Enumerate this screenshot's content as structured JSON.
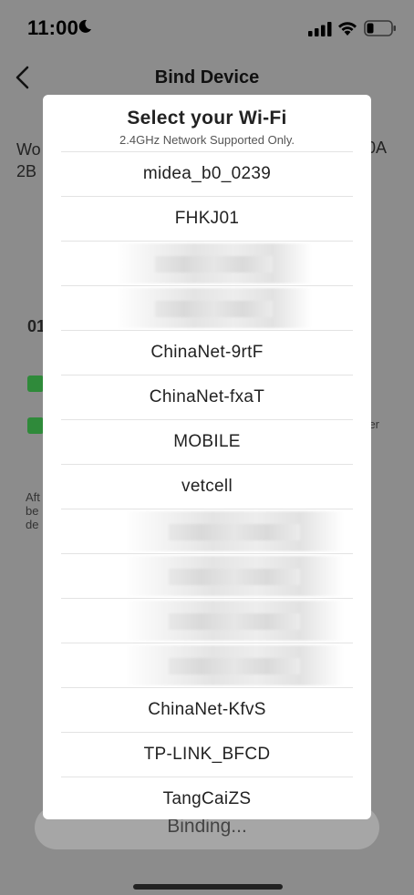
{
  "status_bar": {
    "time": "11:00",
    "icons": [
      "moon-icon",
      "signal-icon",
      "wifi-icon",
      "battery-icon"
    ]
  },
  "nav": {
    "title": "Bind Device",
    "back_icon": "chevron-left-icon"
  },
  "background": {
    "line1": "Wo",
    "line2": "2B",
    "right_text": "0A",
    "number": "01",
    "small_lines": [
      "Aft",
      "be",
      "de"
    ],
    "small_right": "er",
    "check_color": "#2f8a3a",
    "binding_label": "Binding..."
  },
  "modal": {
    "title": "Select your Wi-Fi",
    "subtitle": "2.4GHz Network Supported Only.",
    "networks": [
      {
        "name": "midea_b0_0239",
        "blurred": false
      },
      {
        "name": "FHKJ01",
        "blurred": false
      },
      {
        "name": "",
        "blurred": true
      },
      {
        "name": "",
        "blurred": true
      },
      {
        "name": "ChinaNet-9rtF",
        "blurred": false
      },
      {
        "name": "ChinaNet-fxaT",
        "blurred": false
      },
      {
        "name": "MOBILE",
        "blurred": false
      },
      {
        "name": "vetcell",
        "blurred": false
      },
      {
        "name": "",
        "blurred": true
      },
      {
        "name": "",
        "blurred": true
      },
      {
        "name": "",
        "blurred": true
      },
      {
        "name": "",
        "blurred": true
      },
      {
        "name": "ChinaNet-KfvS",
        "blurred": false
      },
      {
        "name": "TP-LINK_BFCD",
        "blurred": false
      },
      {
        "name": "TangCaiZS",
        "blurred": false
      }
    ]
  }
}
